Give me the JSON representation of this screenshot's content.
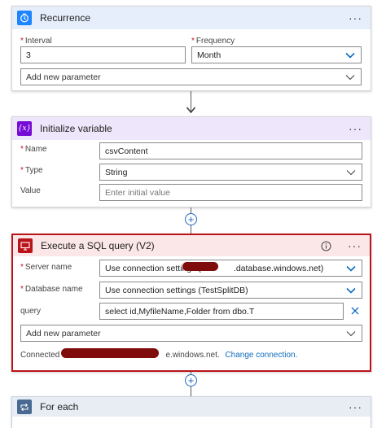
{
  "recurrence": {
    "title": "Recurrence",
    "more": "···",
    "interval_label": "Interval",
    "interval_value": "3",
    "frequency_label": "Frequency",
    "frequency_value": "Month",
    "add_param": "Add new parameter",
    "colors": {
      "header_bg": "#e6eefb",
      "icon_bg": "#1f85ff"
    }
  },
  "init_var": {
    "title": "Initialize variable",
    "more": "···",
    "icon_text": "{x}",
    "name_label": "Name",
    "name_value": "csvContent",
    "type_label": "Type",
    "type_value": "String",
    "value_label": "Value",
    "value_placeholder": "Enter initial value",
    "colors": {
      "header_bg": "#eee6fa",
      "icon_bg": "#770bd6"
    }
  },
  "sql": {
    "title": "Execute a SQL query (V2)",
    "info_icon": "info-icon",
    "more": "···",
    "server_label": "Server name",
    "server_value_prefix": "Use connection settings (",
    "server_value_suffix": ".database.windows.net)",
    "db_label": "Database name",
    "db_value": "Use connection settings (TestSplitDB)",
    "query_label": "query",
    "query_value": "select id,MyfileName,Folder from dbo.T",
    "add_param": "Add new parameter",
    "connected_prefix": "Connected to",
    "connected_suffix": "e.windows.net.",
    "change_connection": "Change connection.",
    "colors": {
      "header_bg": "#fbe7e7",
      "icon_bg": "#ba141a",
      "border": "#ba141a"
    }
  },
  "foreach": {
    "title": "For each",
    "more": "···",
    "colors": {
      "header_bg": "#e8edf4",
      "icon_bg": "#486991"
    }
  },
  "icons": {
    "recurrence": "clock-icon",
    "arrow": "arrow-down-icon",
    "plus": "add-step-icon",
    "chevron": "chevron-down-icon",
    "clear": "close-icon",
    "sql": "monitor-icon",
    "foreach": "loop-icon"
  }
}
